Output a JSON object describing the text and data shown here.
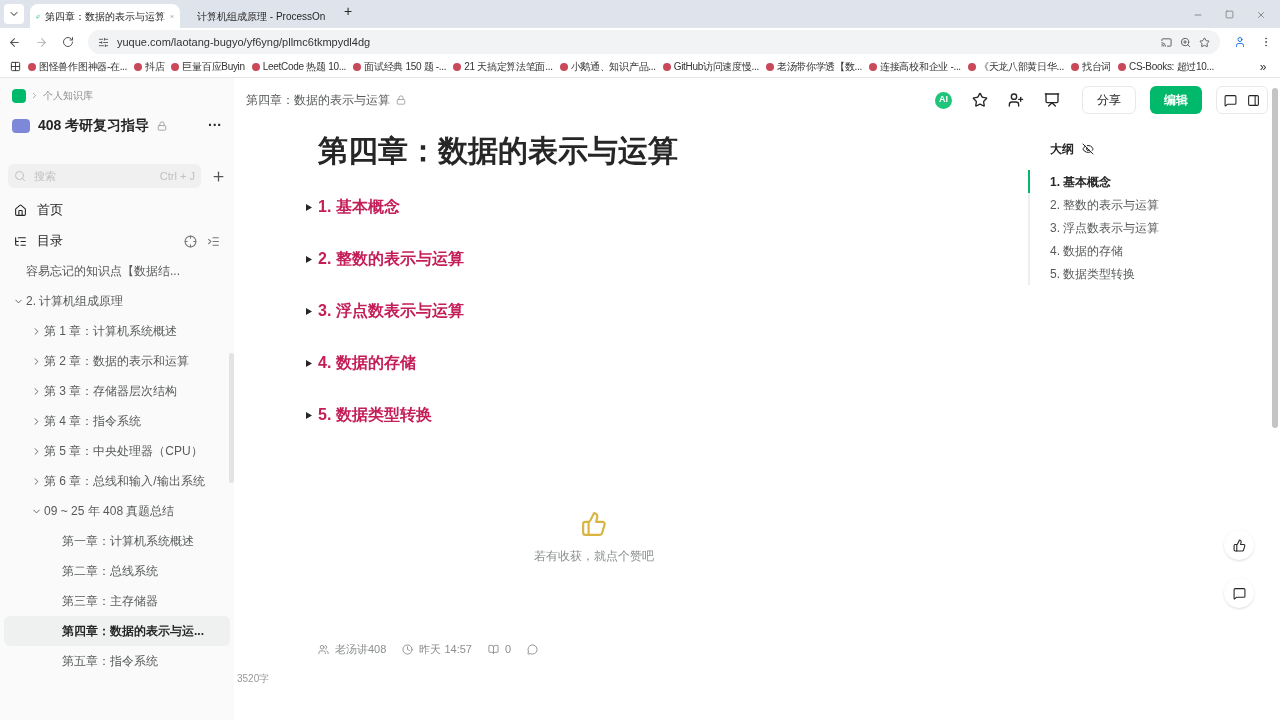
{
  "browser": {
    "tabs": [
      {
        "title": "第四章：数据的表示与运算",
        "selected": true
      },
      {
        "title": "计算机组成原理 - ProcessOn",
        "selected": false
      }
    ],
    "new_tab": "+",
    "url": "yuque.com/laotang-bugyo/yf6yng/pllmc6tkmpydl4dg",
    "bookmarks": [
      "图怪兽作图神器-在...",
      "抖店",
      "巨量百应Buyin",
      "LeetCode 热题 10...",
      "面试经典 150 题 -...",
      "21 天搞定算法笔面...",
      "小鹅通、知识产品...",
      "GitHub访问速度慢...",
      "老汤带你学透【数...",
      "连接高校和企业 -...",
      "《天龙八部黄日华...",
      "找台词",
      "CS-Books: 超过10..."
    ],
    "more": "»"
  },
  "sidebar": {
    "breadcrumb": "个人知识库",
    "book_title": "408 考研复习指导",
    "more": "···",
    "search": {
      "placeholder": "搜索",
      "shortcut": "Ctrl + J"
    },
    "home": "首页",
    "toc": "目录",
    "tree": [
      {
        "label": "容易忘记的知识点【数据结...",
        "selected": false
      },
      {
        "label": "2. 计算机组成原理",
        "selected": false,
        "expanded": true,
        "children": [
          {
            "label": "第 1 章：计算机系统概述",
            "selected": false,
            "expanded": false
          },
          {
            "label": "第 2 章：数据的表示和运算",
            "selected": false,
            "expanded": false
          },
          {
            "label": "第 3 章：存储器层次结构",
            "selected": false,
            "expanded": false
          },
          {
            "label": "第 4 章：指令系统",
            "selected": false,
            "expanded": false
          },
          {
            "label": "第 5 章：中央处理器（CPU）",
            "selected": false,
            "expanded": false
          },
          {
            "label": "第 6 章：总线和输入/输出系统",
            "selected": false,
            "expanded": false
          },
          {
            "label": "09 ~ 25 年 408 真题总结",
            "selected": false,
            "expanded": true,
            "children": [
              {
                "label": "第一章：计算机系统概述",
                "selected": false
              },
              {
                "label": "第二章：总线系统",
                "selected": false
              },
              {
                "label": "第三章：主存储器",
                "selected": false
              },
              {
                "label": "第四章：数据的表示与运...",
                "selected": true
              },
              {
                "label": "第五章：指令系统",
                "selected": false
              }
            ]
          }
        ]
      }
    ]
  },
  "header": {
    "doc_title": "第四章：数据的表示与运算",
    "ai": "AI",
    "share": "分享",
    "edit": "编辑"
  },
  "document": {
    "title": "第四章：数据的表示与运算",
    "sections": [
      {
        "label": "1. 基本概念",
        "expanded": false
      },
      {
        "label": "2. 整数的表示与运算",
        "expanded": false
      },
      {
        "label": "3. 浮点数表示与运算",
        "expanded": false
      },
      {
        "label": "4. 数据的存储",
        "expanded": false
      },
      {
        "label": "5. 数据类型转换",
        "expanded": false
      }
    ],
    "like_prompt": "若有收获，就点个赞吧",
    "word_count": "3520字",
    "author": "老汤讲408",
    "updated": "昨天 14:57",
    "count": "0"
  },
  "outline": {
    "title": "大纲",
    "items": [
      {
        "label": "1. 基本概念",
        "selected": true
      },
      {
        "label": "2. 整数的表示与运算",
        "selected": false
      },
      {
        "label": "3. 浮点数表示与运算",
        "selected": false
      },
      {
        "label": "4. 数据的存储",
        "selected": false
      },
      {
        "label": "5. 数据类型转换",
        "selected": false
      }
    ]
  }
}
